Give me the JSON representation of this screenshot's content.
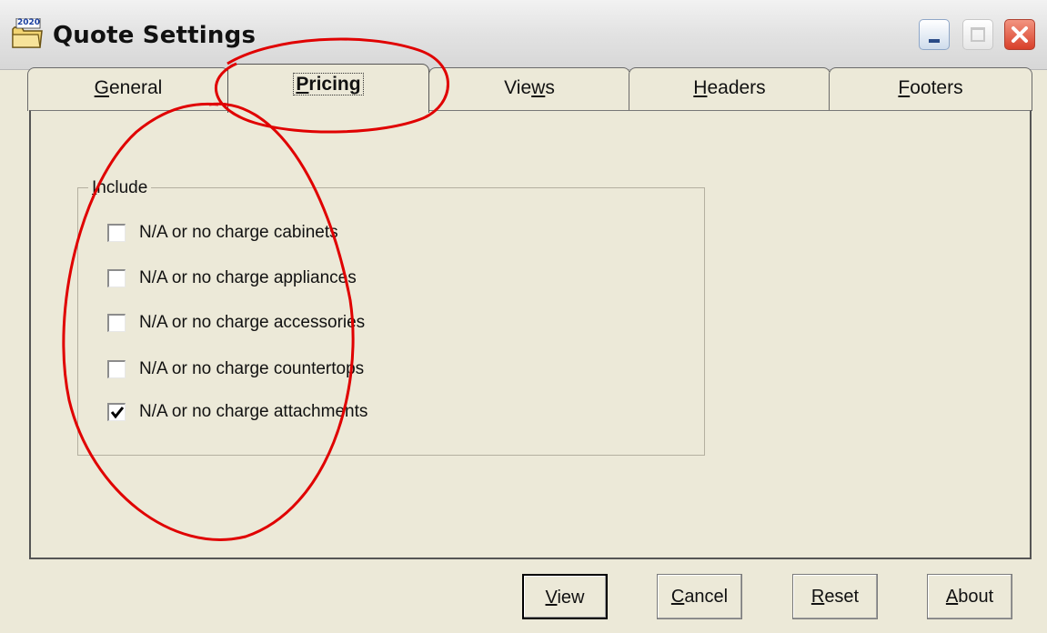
{
  "window": {
    "title": "Quote Settings",
    "app_icon_badge": "2020"
  },
  "tabs": [
    {
      "label_before": "",
      "mnemonic": "G",
      "label_after": "eneral",
      "active": false
    },
    {
      "label_before": "",
      "mnemonic": "P",
      "label_after": "ricing",
      "active": true
    },
    {
      "label_before": "Vie",
      "mnemonic": "w",
      "label_after": "s",
      "active": false
    },
    {
      "label_before": "",
      "mnemonic": "H",
      "label_after": "eaders",
      "active": false
    },
    {
      "label_before": "",
      "mnemonic": "F",
      "label_after": "ooters",
      "active": false
    }
  ],
  "group": {
    "title_before": "",
    "mnemonic": "I",
    "title_after": "nclude"
  },
  "options": [
    {
      "label": "N/A or no charge cabinets",
      "checked": false
    },
    {
      "label": "N/A or no charge appliances",
      "checked": false
    },
    {
      "label": "N/A or no charge accessories",
      "checked": false
    },
    {
      "label": "N/A or no charge countertops",
      "checked": false
    },
    {
      "label": "N/A or no charge attachments",
      "checked": true
    }
  ],
  "buttons": {
    "view": {
      "mnemonic": "V",
      "rest": "iew"
    },
    "cancel": {
      "mnemonic": "C",
      "rest": "ancel"
    },
    "reset": {
      "mnemonic": "R",
      "rest": "eset"
    },
    "about": {
      "mnemonic": "A",
      "rest": "bout"
    }
  },
  "colors": {
    "window_bg": "#ece9d8",
    "annotation_red": "#e00000",
    "close_button": "#d8402a"
  }
}
